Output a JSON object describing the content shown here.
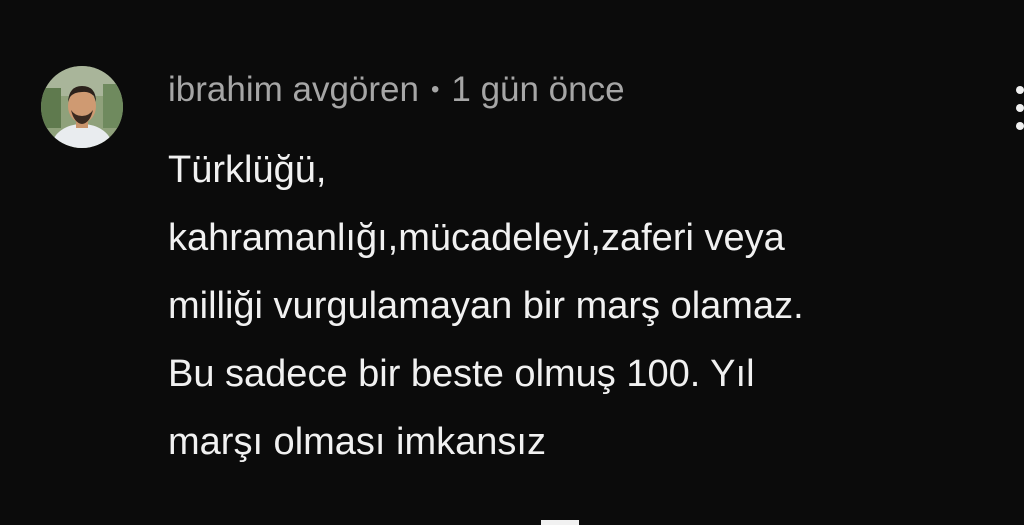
{
  "comment": {
    "author": "ibrahim avgören",
    "separator": "•",
    "timestamp": "1 gün önce",
    "lines": [
      "Türklüğü,",
      "kahramanlığı,mücadeleyi,zaferi veya",
      "milliği vurgulamayan bir marş olamaz.",
      "Bu sadece bir beste olmuş 100. Yıl",
      "marşı olması imkansız"
    ],
    "more_icon": "more-vertical-icon"
  },
  "colors": {
    "background": "#0b0b0b",
    "meta_text": "#a6a6a6",
    "body_text": "#f1f1f1"
  }
}
